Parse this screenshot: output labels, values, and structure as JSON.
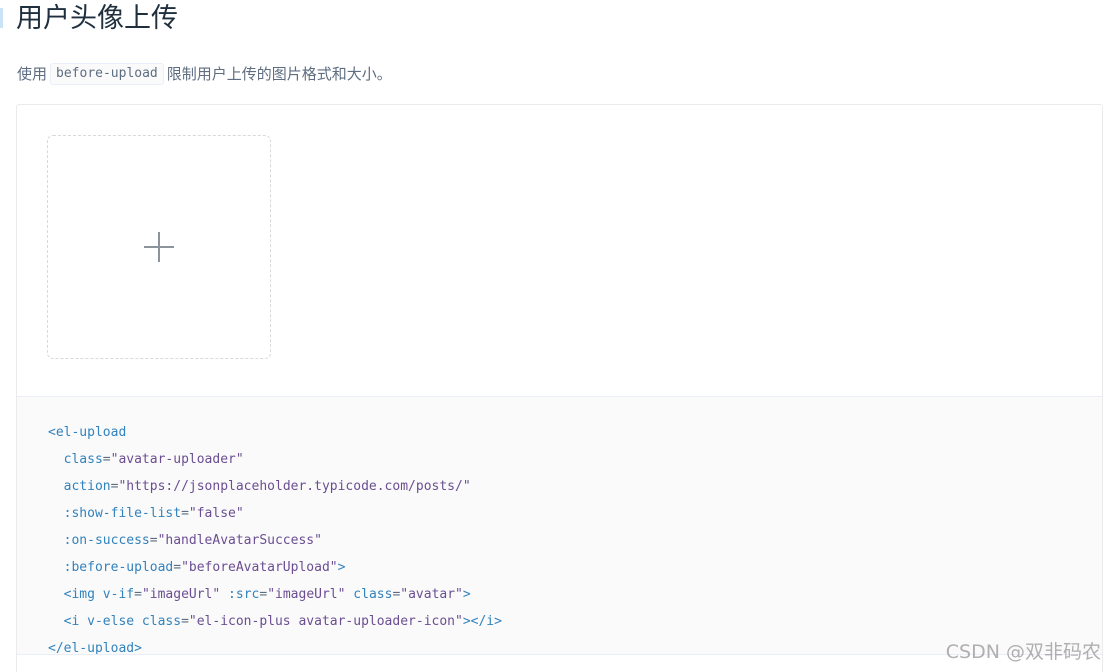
{
  "page": {
    "title": "用户头像上传",
    "desc_before": "使用",
    "desc_code": "before-upload",
    "desc_after": "限制用户上传的图片格式和大小。"
  },
  "uploader": {
    "icon": "plus-icon"
  },
  "code": {
    "lines": [
      [
        {
          "t": "tag",
          "v": "<el-upload"
        }
      ],
      [
        {
          "t": "attr",
          "v": "  class"
        },
        {
          "t": "eq",
          "v": "="
        },
        {
          "t": "str",
          "v": "\"avatar-uploader\""
        }
      ],
      [
        {
          "t": "attr",
          "v": "  action"
        },
        {
          "t": "eq",
          "v": "="
        },
        {
          "t": "str",
          "v": "\"https://jsonplaceholder.typicode.com/posts/\""
        }
      ],
      [
        {
          "t": "attr",
          "v": "  :show-file-list"
        },
        {
          "t": "eq",
          "v": "="
        },
        {
          "t": "str",
          "v": "\"false\""
        }
      ],
      [
        {
          "t": "attr",
          "v": "  :on-success"
        },
        {
          "t": "eq",
          "v": "="
        },
        {
          "t": "str",
          "v": "\"handleAvatarSuccess\""
        }
      ],
      [
        {
          "t": "attr",
          "v": "  :before-upload"
        },
        {
          "t": "eq",
          "v": "="
        },
        {
          "t": "str",
          "v": "\"beforeAvatarUpload\""
        },
        {
          "t": "punc",
          "v": ">"
        }
      ],
      [
        {
          "t": "tag",
          "v": "  <img"
        },
        {
          "t": "attr",
          "v": " v-if"
        },
        {
          "t": "eq",
          "v": "="
        },
        {
          "t": "str",
          "v": "\"imageUrl\""
        },
        {
          "t": "attr",
          "v": " :src"
        },
        {
          "t": "eq",
          "v": "="
        },
        {
          "t": "str",
          "v": "\"imageUrl\""
        },
        {
          "t": "attr",
          "v": " class"
        },
        {
          "t": "eq",
          "v": "="
        },
        {
          "t": "str",
          "v": "\"avatar\""
        },
        {
          "t": "punc",
          "v": ">"
        }
      ],
      [
        {
          "t": "tag",
          "v": "  <i"
        },
        {
          "t": "attr",
          "v": " v-else class"
        },
        {
          "t": "eq",
          "v": "="
        },
        {
          "t": "str",
          "v": "\"el-icon-plus avatar-uploader-icon\""
        },
        {
          "t": "punc",
          "v": "></i>"
        }
      ],
      [
        {
          "t": "tag",
          "v": "</el-upload>"
        }
      ]
    ]
  },
  "watermark": "CSDN @双非码农"
}
